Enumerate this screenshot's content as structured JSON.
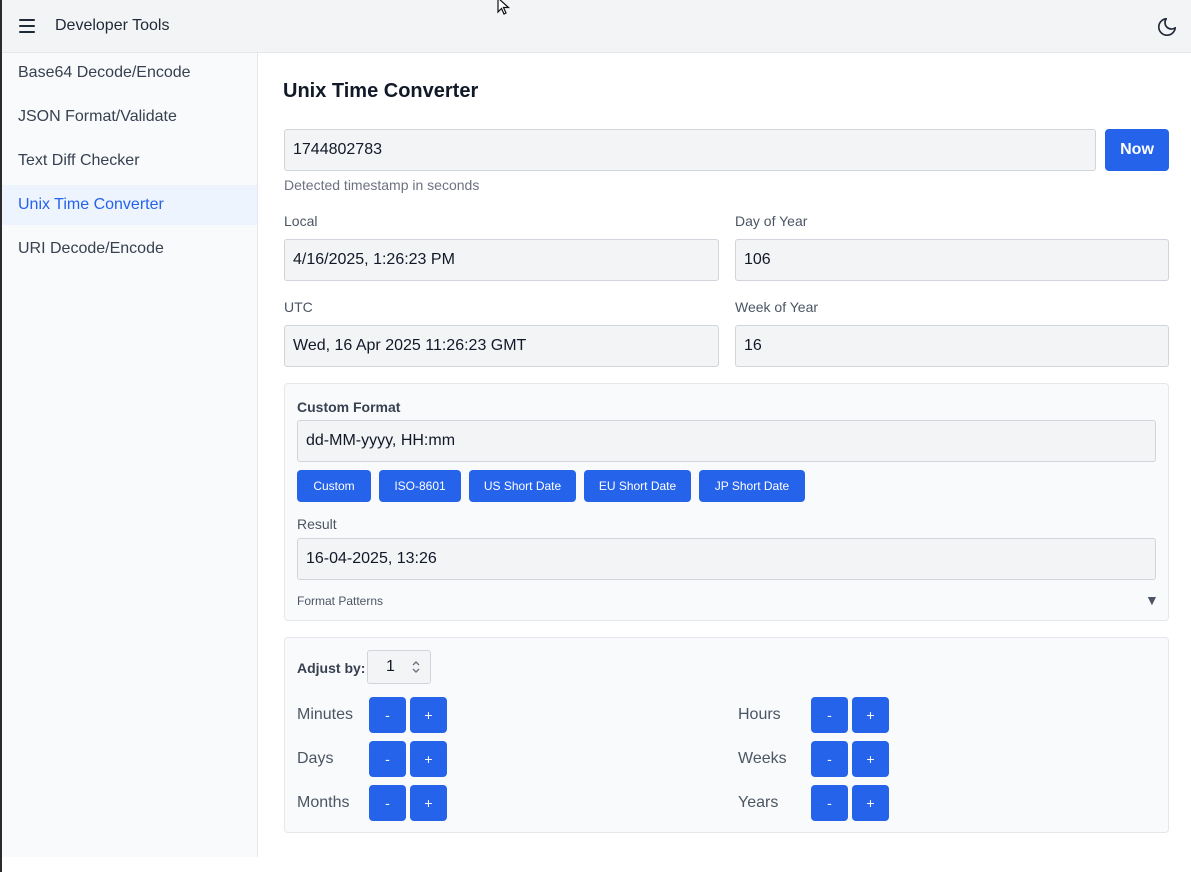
{
  "app": {
    "title": "Developer Tools",
    "icons": {
      "menu": "hamburger-menu-icon",
      "theme": "moon-icon"
    }
  },
  "sidebar": {
    "items": [
      {
        "label": "Base64 Decode/Encode",
        "active": false
      },
      {
        "label": "JSON Format/Validate",
        "active": false
      },
      {
        "label": "Text Diff Checker",
        "active": false
      },
      {
        "label": "Unix Time Converter",
        "active": true
      },
      {
        "label": "URI Decode/Encode",
        "active": false
      }
    ]
  },
  "main": {
    "title": "Unix Time Converter",
    "timestamp": {
      "value": "1744802783",
      "hint": "Detected timestamp in seconds",
      "now_label": "Now"
    },
    "fields": {
      "local": {
        "label": "Local",
        "value": "4/16/2025, 1:26:23 PM"
      },
      "day_of_year": {
        "label": "Day of Year",
        "value": "106"
      },
      "utc": {
        "label": "UTC",
        "value": "Wed, 16 Apr 2025 11:26:23 GMT"
      },
      "week_of_year": {
        "label": "Week of Year",
        "value": "16"
      }
    },
    "custom_format": {
      "label": "Custom Format",
      "value": "dd-MM-yyyy, HH:mm",
      "presets": [
        "Custom",
        "ISO-8601",
        "US Short Date",
        "EU Short Date",
        "JP Short Date"
      ],
      "result_label": "Result",
      "result_value": "16-04-2025, 13:26",
      "patterns_label": "Format Patterns",
      "patterns_toggle": "▼"
    },
    "adjust": {
      "label": "Adjust by:",
      "amount": "1",
      "minus": "-",
      "plus": "+",
      "units": [
        "Minutes",
        "Hours",
        "Days",
        "Weeks",
        "Months",
        "Years"
      ]
    }
  },
  "colors": {
    "accent": "#2563eb",
    "active_bg": "#eef4fe"
  }
}
